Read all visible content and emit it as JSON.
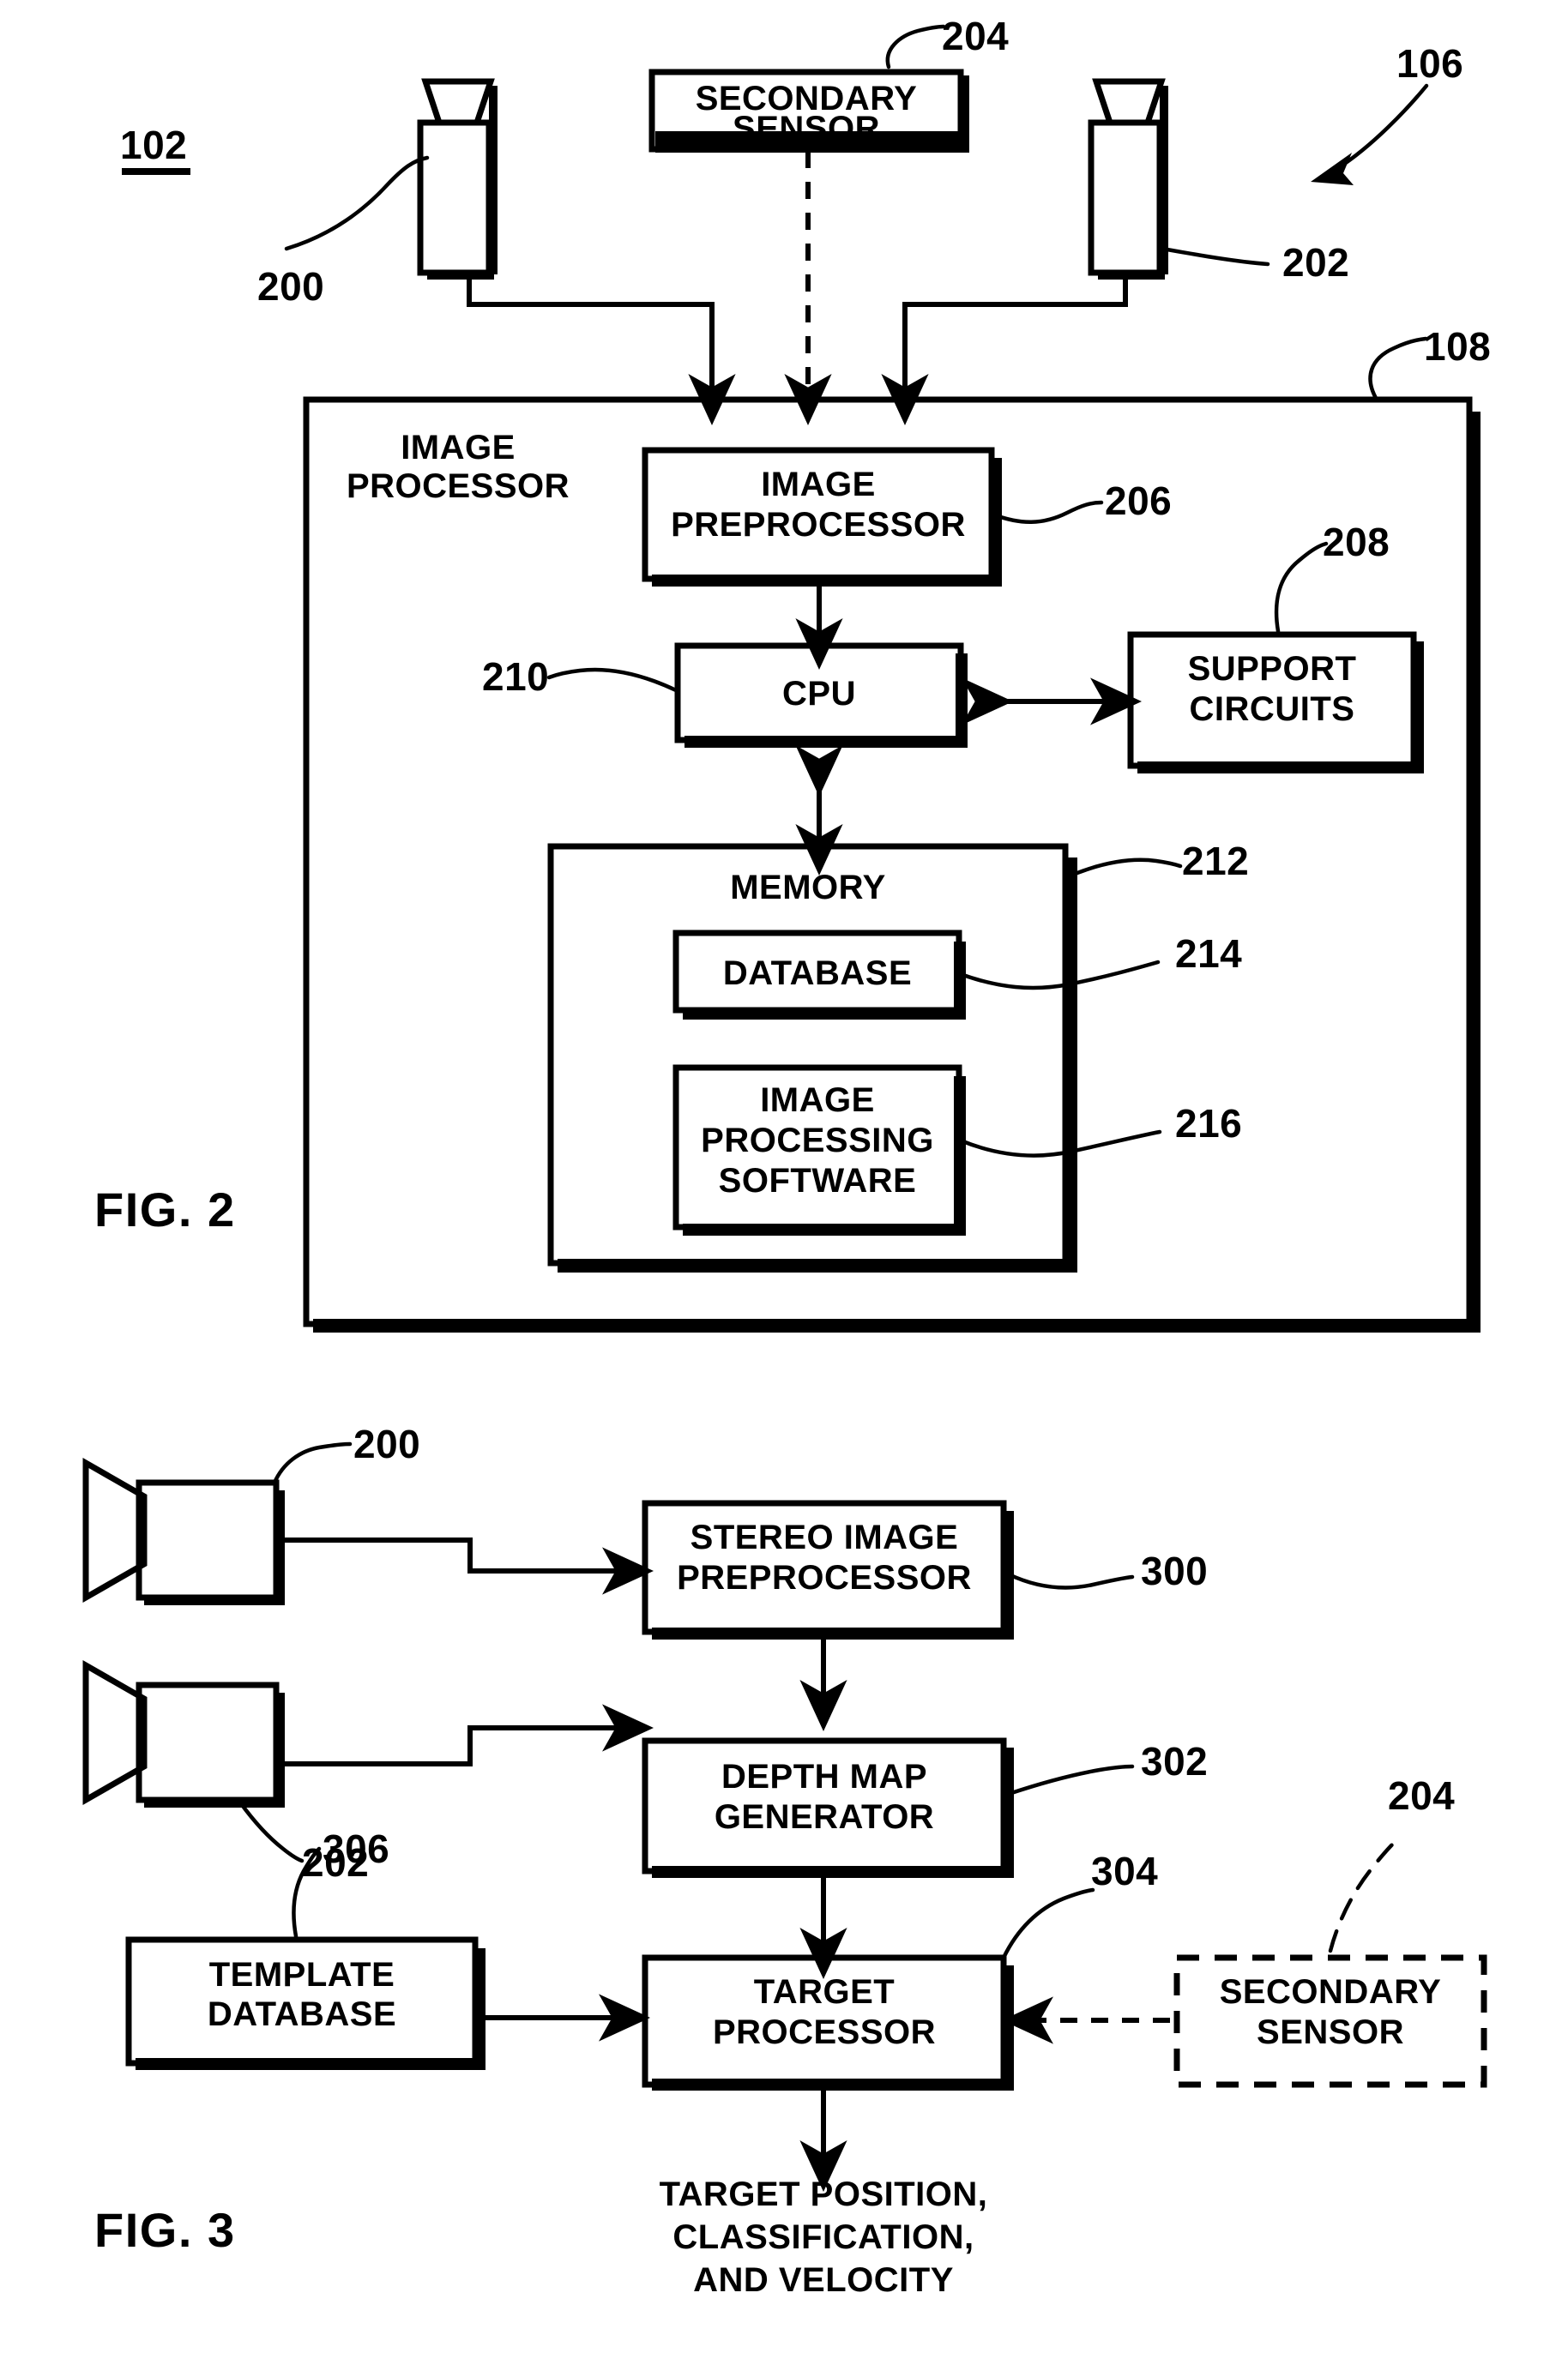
{
  "document": {
    "type": "patent-drawing-sheet",
    "figures": [
      "FIG. 2",
      "FIG. 3"
    ]
  },
  "fig2": {
    "label": "FIG. 2",
    "system_ref": "102",
    "assembly_ref": "106",
    "processor_ref": "108",
    "camera_left": {
      "ref": "200",
      "icon": "camera-icon"
    },
    "camera_right": {
      "ref": "202",
      "icon": "camera-icon"
    },
    "secondary_sensor": {
      "label_line1": "SECONDARY",
      "label_line2": "SENSOR",
      "ref": "204"
    },
    "image_processor": {
      "label_line1": "IMAGE",
      "label_line2": "PROCESSOR"
    },
    "image_preprocessor": {
      "label_line1": "IMAGE",
      "label_line2": "PREPROCESSOR",
      "ref": "206"
    },
    "support_circuits": {
      "label_line1": "SUPPORT",
      "label_line2": "CIRCUITS",
      "ref": "208"
    },
    "cpu": {
      "label": "CPU",
      "ref": "210"
    },
    "memory": {
      "label": "MEMORY",
      "ref": "212"
    },
    "database": {
      "label": "DATABASE",
      "ref": "214"
    },
    "image_processing_software": {
      "label_line1": "IMAGE",
      "label_line2": "PROCESSING",
      "label_line3": "SOFTWARE",
      "ref": "216"
    }
  },
  "fig3": {
    "label": "FIG. 3",
    "camera_top": {
      "ref": "200",
      "icon": "camera-icon"
    },
    "camera_bottom": {
      "ref": "202",
      "icon": "camera-icon"
    },
    "stereo_image_preprocessor": {
      "label_line1": "STEREO IMAGE",
      "label_line2": "PREPROCESSOR",
      "ref": "300"
    },
    "depth_map_generator": {
      "label_line1": "DEPTH MAP",
      "label_line2": "GENERATOR",
      "ref": "302"
    },
    "target_processor": {
      "label_line1": "TARGET",
      "label_line2": "PROCESSOR",
      "ref": "304"
    },
    "template_database": {
      "label_line1": "TEMPLATE",
      "label_line2": "DATABASE",
      "ref": "306"
    },
    "secondary_sensor": {
      "label_line1": "SECONDARY",
      "label_line2": "SENSOR",
      "ref": "204",
      "style": "dashed"
    },
    "output": {
      "line1": "TARGET POSITION,",
      "line2": "CLASSIFICATION,",
      "line3": "AND VELOCITY"
    }
  },
  "colors": {
    "ink": "#000000",
    "paper": "#ffffff"
  }
}
